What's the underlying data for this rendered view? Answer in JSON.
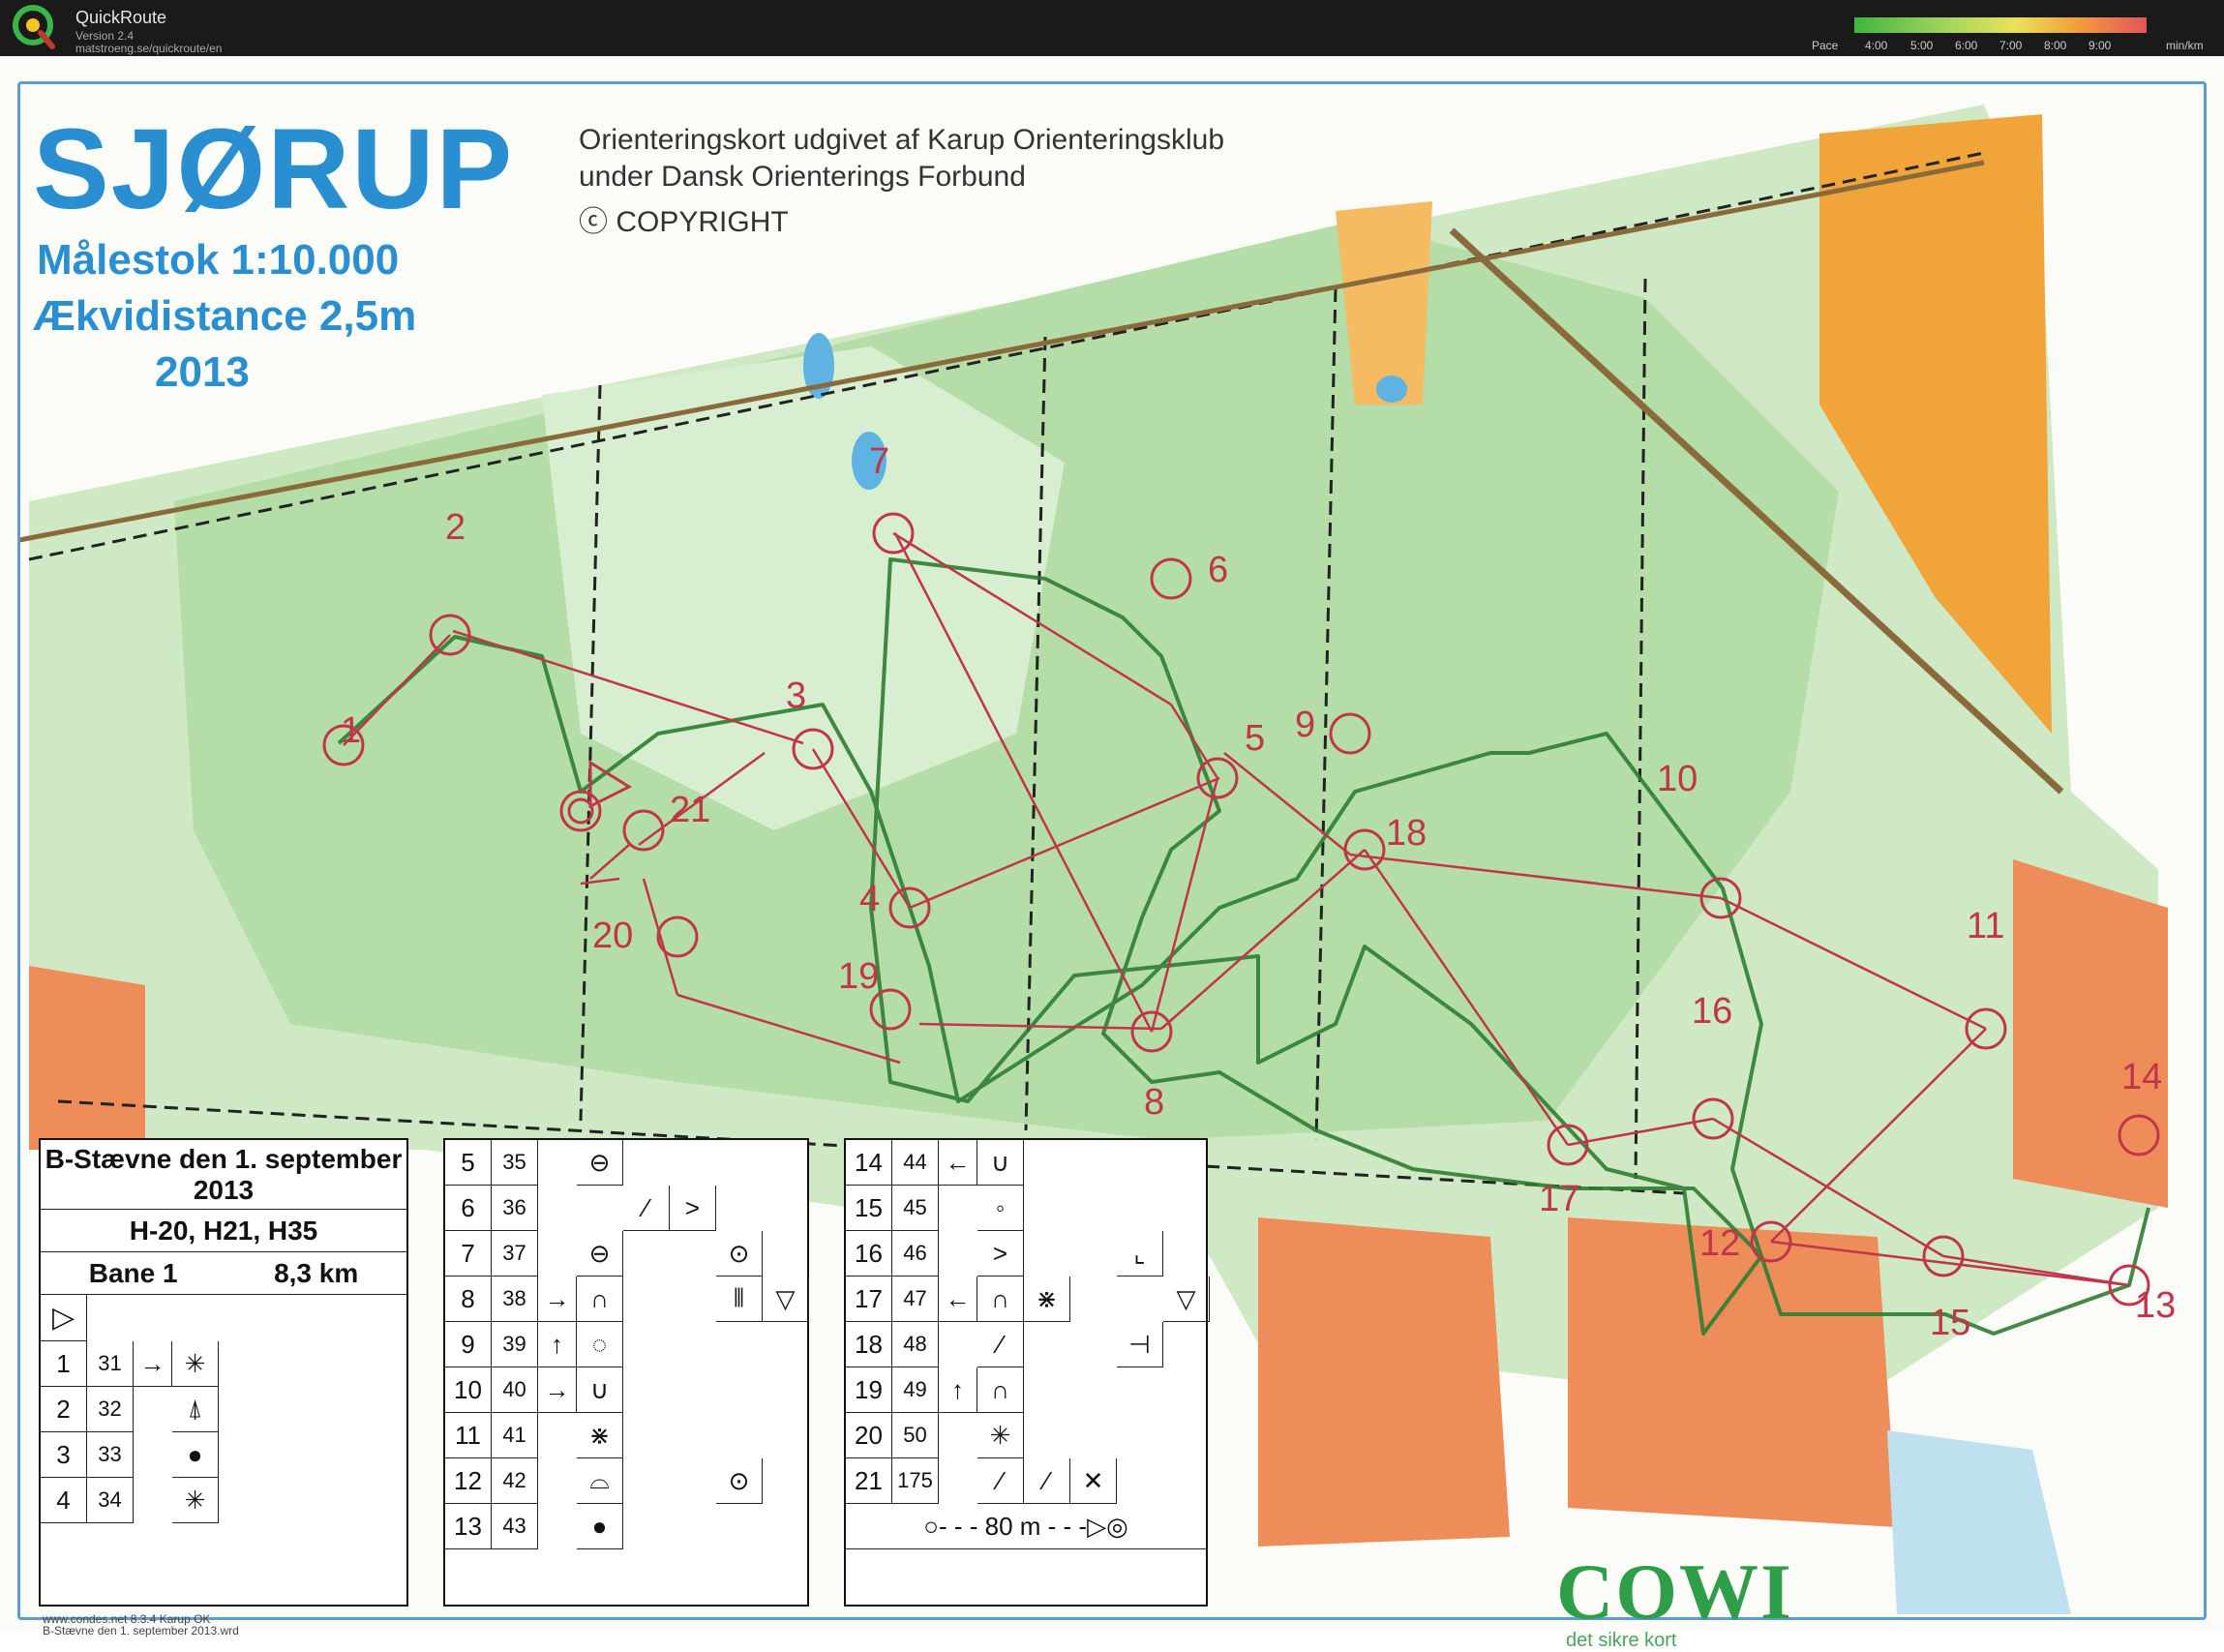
{
  "app": {
    "name": "QuickRoute",
    "version": "Version 2.4",
    "url": "matstroeng.se/quickroute/en"
  },
  "pace_scale": {
    "label": "Pace",
    "ticks": [
      "4:00",
      "5:00",
      "6:00",
      "7:00",
      "8:00",
      "9:00"
    ],
    "unit": "min/km",
    "colors": [
      "#3fb53f",
      "#9ed45c",
      "#e9e35a",
      "#f2a23c",
      "#e4545a"
    ]
  },
  "map": {
    "title": "SJØRUP",
    "publisher_lines": [
      "Orienteringskort udgivet af Karup Orienteringsklub",
      "under Dansk Orienterings Forbund",
      "ⓒ COPYRIGHT"
    ],
    "scale": "Målestok 1:10.000",
    "contour_interval": "Ækvidistance 2,5m",
    "year": "2013",
    "route_color": "#2e7d32",
    "course_color": "#c0354a",
    "forest_color": "#a9d89a",
    "open_color": "#f0a43a"
  },
  "controls": [
    "1",
    "2",
    "3",
    "4",
    "5",
    "6",
    "7",
    "8",
    "9",
    "10",
    "11",
    "12",
    "13",
    "14",
    "15",
    "16",
    "17",
    "18",
    "19",
    "20",
    "21"
  ],
  "legend": {
    "event": "B-Stævne den 1. september",
    "event_year": "2013",
    "classes": "H-20, H21, H35",
    "course": "Bane 1",
    "length": "8,3 km",
    "left_rows": [
      {
        "num": "1",
        "code": "31"
      },
      {
        "num": "2",
        "code": "32"
      },
      {
        "num": "3",
        "code": "33"
      },
      {
        "num": "4",
        "code": "34"
      }
    ],
    "mid_rows": [
      {
        "num": "5",
        "code": "35"
      },
      {
        "num": "6",
        "code": "36"
      },
      {
        "num": "7",
        "code": "37"
      },
      {
        "num": "8",
        "code": "38"
      },
      {
        "num": "9",
        "code": "39"
      },
      {
        "num": "10",
        "code": "40"
      },
      {
        "num": "11",
        "code": "41"
      },
      {
        "num": "12",
        "code": "42"
      },
      {
        "num": "13",
        "code": "43"
      }
    ],
    "right_rows": [
      {
        "num": "14",
        "code": "44"
      },
      {
        "num": "15",
        "code": "45"
      },
      {
        "num": "16",
        "code": "46"
      },
      {
        "num": "17",
        "code": "47"
      },
      {
        "num": "18",
        "code": "48"
      },
      {
        "num": "19",
        "code": "49"
      },
      {
        "num": "20",
        "code": "50"
      },
      {
        "num": "21",
        "code": "175"
      }
    ],
    "finish_distance": "80 m",
    "footer_1": "www.condes.net 8.3.4 Karup OK",
    "footer_2": "B-Stævne den 1. september 2013.wrd"
  },
  "sponsor": {
    "name": "COWI",
    "tagline": "det sikre kort"
  }
}
